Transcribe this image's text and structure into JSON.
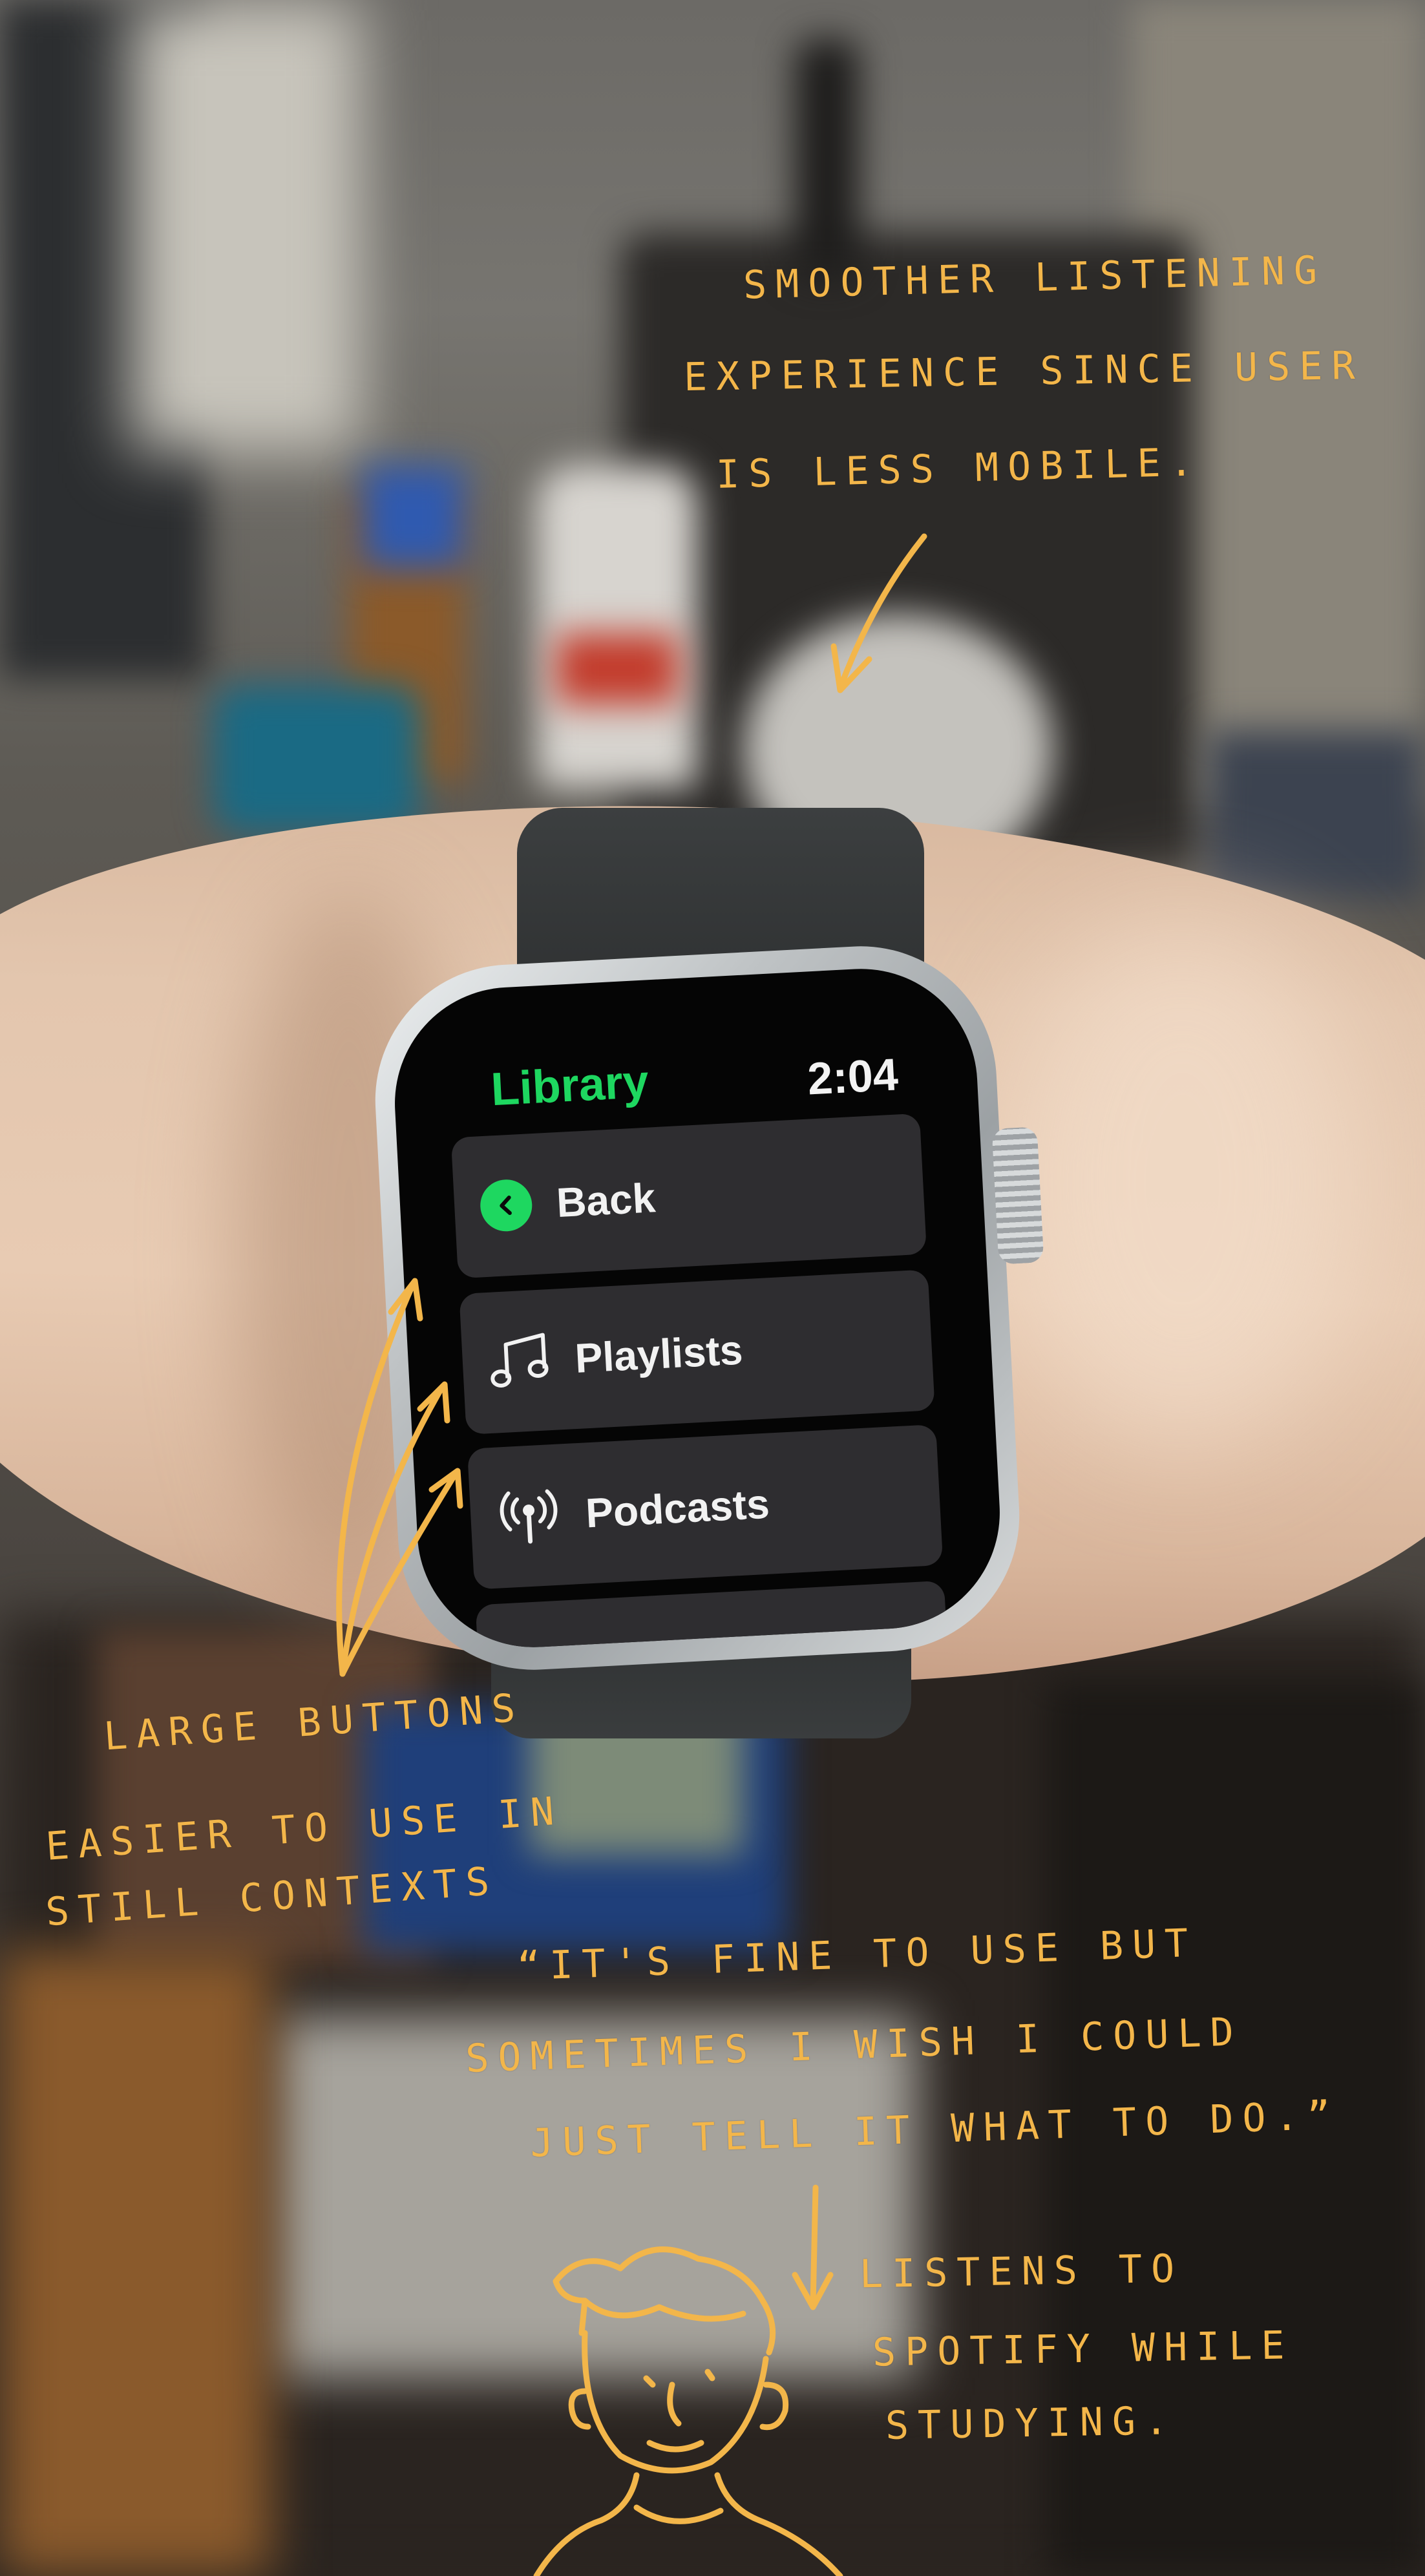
{
  "watch": {
    "title": "Library",
    "time": "2:04",
    "menu": [
      {
        "label": "Back",
        "icon": "chevron-left-icon"
      },
      {
        "label": "Playlists",
        "icon": "music-note-icon"
      },
      {
        "label": "Podcasts",
        "icon": "podcast-icon"
      }
    ],
    "accent_color": "#1ed760",
    "button_color": "#2e2d30"
  },
  "annotations": {
    "top_note": [
      "Smoother listening",
      "experience since user",
      "is less mobile."
    ],
    "left_note": [
      "Large buttons",
      "easier to use in",
      "still contexts"
    ],
    "quote": [
      "“It's fine to use but",
      "sometimes I wish I could",
      "just tell it what to do.”"
    ],
    "persona_note": [
      "Listens to",
      "Spotify while",
      "studying."
    ],
    "ink_color": "#f3b64a"
  }
}
